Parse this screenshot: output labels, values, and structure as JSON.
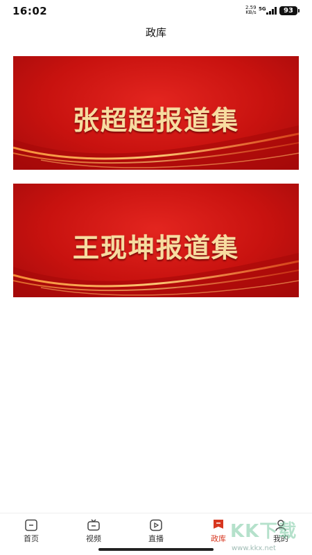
{
  "status_bar": {
    "time": "16:02",
    "speed_value": "2.59",
    "speed_unit": "KB/s",
    "network": "5G",
    "battery": "93"
  },
  "header": {
    "title": "政库"
  },
  "banners": [
    {
      "title": "张超超报道集"
    },
    {
      "title": "王现坤报道集"
    }
  ],
  "bottom_nav": {
    "items": [
      {
        "label": "首页",
        "icon": "home-icon"
      },
      {
        "label": "视频",
        "icon": "tv-icon"
      },
      {
        "label": "直播",
        "icon": "live-play-icon"
      },
      {
        "label": "政库",
        "icon": "bookmark-icon",
        "active": true
      },
      {
        "label": "我的",
        "icon": "person-icon"
      }
    ]
  },
  "watermark": {
    "text": "KK下载",
    "url": "www.kkx.net"
  },
  "colors": {
    "accent": "#d7361f",
    "banner_red": "#c8120f",
    "banner_text": "#f7dca0"
  }
}
